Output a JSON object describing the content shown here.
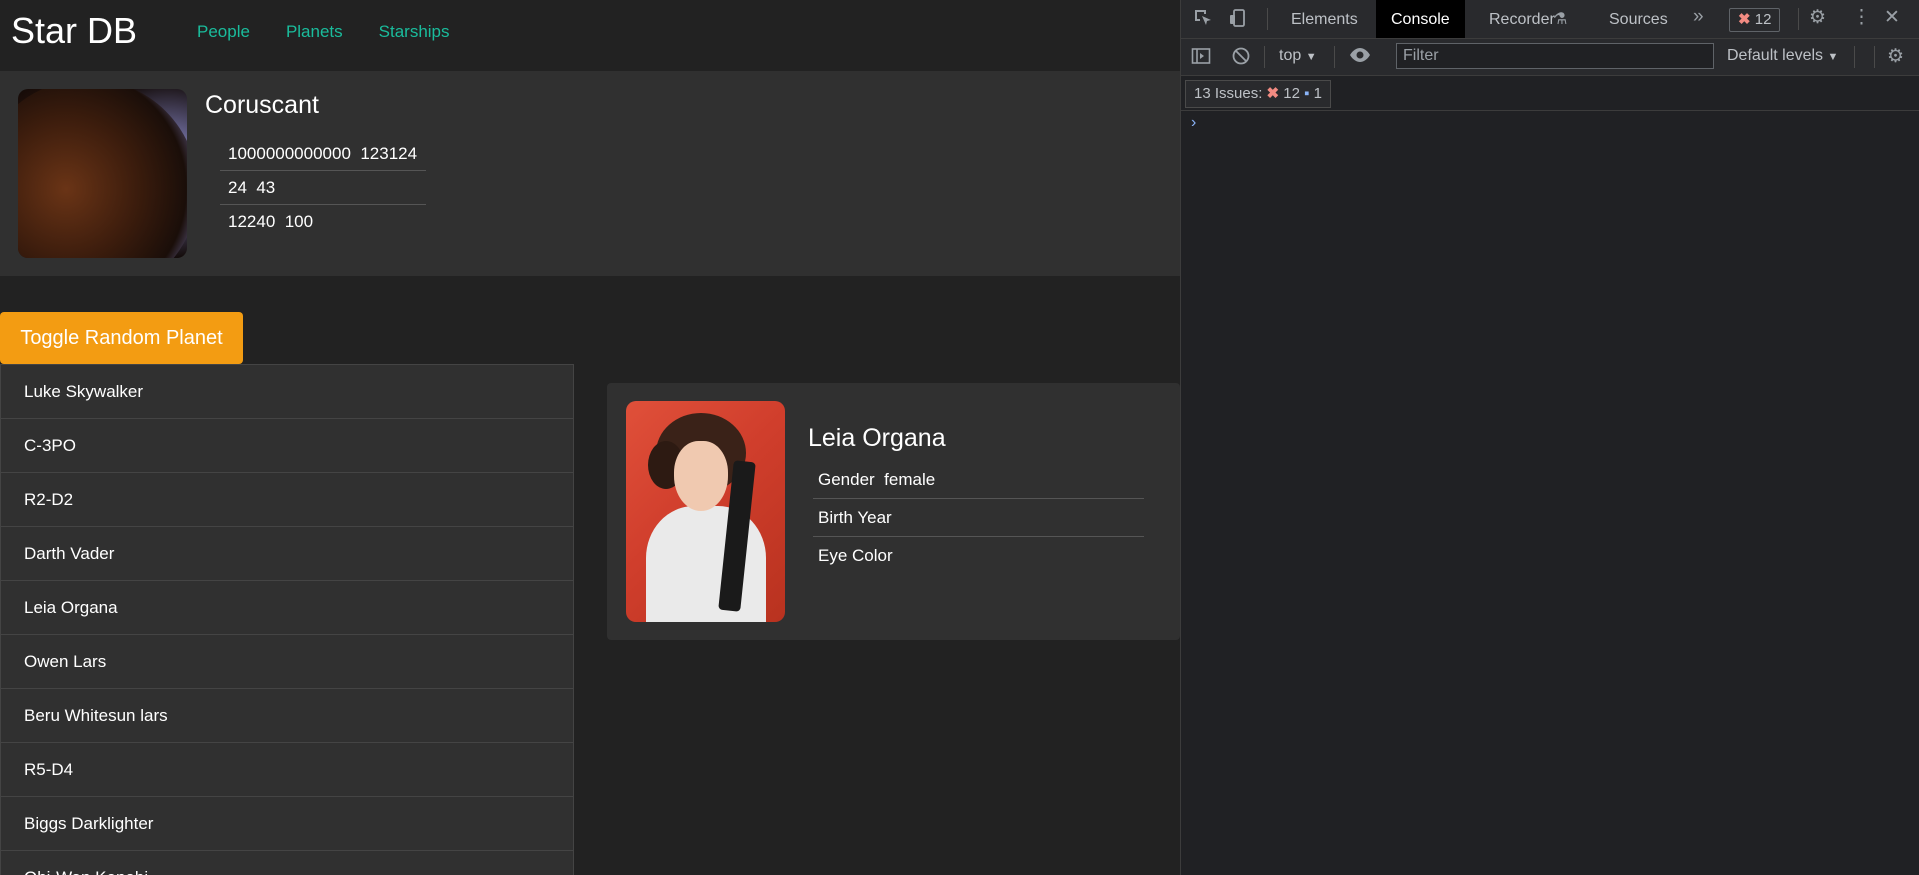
{
  "app": {
    "brand": "Star DB",
    "nav": [
      "People",
      "Planets",
      "Starships"
    ],
    "random_planet": {
      "name": "Coruscant",
      "rows": [
        "1000000000000  123124",
        "24  43",
        "12240  100"
      ]
    },
    "toggle_label": "Toggle Random Planet",
    "people_list": [
      "Luke Skywalker",
      "C-3PO",
      "R2-D2",
      "Darth Vader",
      "Leia Organa",
      "Owen Lars",
      "Beru Whitesun lars",
      "R5-D4",
      "Biggs Darklighter",
      "Obi-Wan Kenobi"
    ],
    "person": {
      "name": "Leia Organa",
      "details": [
        "Gender  female",
        "Birth Year",
        "Eye Color"
      ]
    }
  },
  "devtools": {
    "tabs": [
      "Elements",
      "Console",
      "Recorder",
      "Sources"
    ],
    "active_tab": "Console",
    "error_count": "12",
    "context": "top",
    "filter_placeholder": "Filter",
    "levels": "Default levels",
    "issues": {
      "label": "13 Issues:",
      "errors": "12",
      "infos": "1"
    },
    "prompt": "›"
  },
  "colors": {
    "accent": "#1abc9c",
    "button": "#f39c12",
    "background": "#222222",
    "card": "#303030"
  }
}
